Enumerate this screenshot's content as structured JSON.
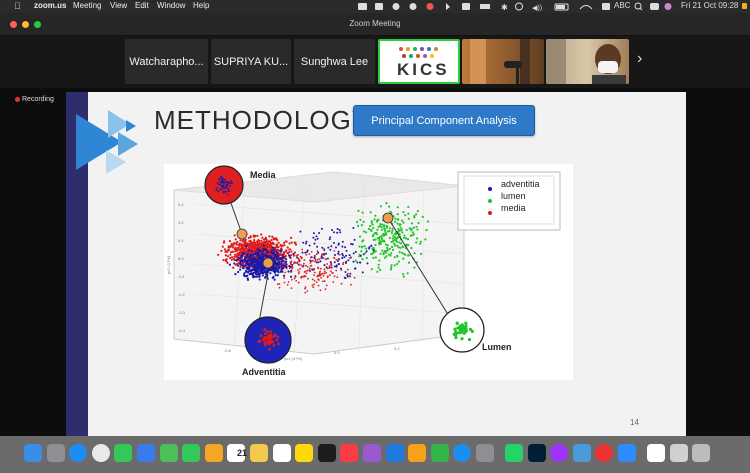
{
  "menubar": {
    "apple": "",
    "app_name": "zoom.us",
    "menus": [
      "Meeting",
      "View",
      "Edit",
      "Window",
      "Help"
    ],
    "status_abc": "ABC",
    "datetime": "Fri 21 Oct  09:28"
  },
  "window": {
    "title": "Zoom Meeting"
  },
  "participants": [
    {
      "name": "Watcharapho..."
    },
    {
      "name": "SUPRIYA KU..."
    },
    {
      "name": "Sunghwa Lee"
    },
    {
      "name": "KICS"
    },
    {
      "name": ""
    },
    {
      "name": ""
    }
  ],
  "strip_next": "›",
  "recording": "Recording",
  "slide": {
    "title": "METHODOLOGY",
    "button": "Principal Component Analysis",
    "page_number": "14",
    "figure": {
      "legend": [
        "adventitia",
        "lumen",
        "media"
      ],
      "callouts": {
        "media": "Media",
        "adventitia": "Adventitia",
        "lumen": "Lumen"
      },
      "colors": {
        "adventitia": "#1a1aa8",
        "lumen": "#22c52a",
        "media": "#e01b1b"
      }
    }
  },
  "colors": {
    "accent": "#2f79c9",
    "slide_strip": "#2d2e6b"
  },
  "dock": {
    "calendar_day": "21",
    "apps": [
      "finder-icon",
      "launchpad-icon",
      "safari-icon",
      "chrome-icon",
      "messages-icon",
      "mail-icon",
      "maps-icon",
      "facetime-icon",
      "photos-icon",
      "calendar-icon",
      "notes-icon",
      "reminders-icon",
      "notes-yellow-icon",
      "tv-icon",
      "music-icon",
      "podcasts-icon",
      "keynote-icon",
      "pages-icon",
      "numbers-icon",
      "appstore-icon",
      "settings-icon",
      "whatsapp-icon",
      "photoshop-icon",
      "messenger-icon",
      "preview-icon",
      "screen-record-icon",
      "zoom-icon",
      "document-icon",
      "finder-window-icon",
      "trash-icon"
    ]
  }
}
